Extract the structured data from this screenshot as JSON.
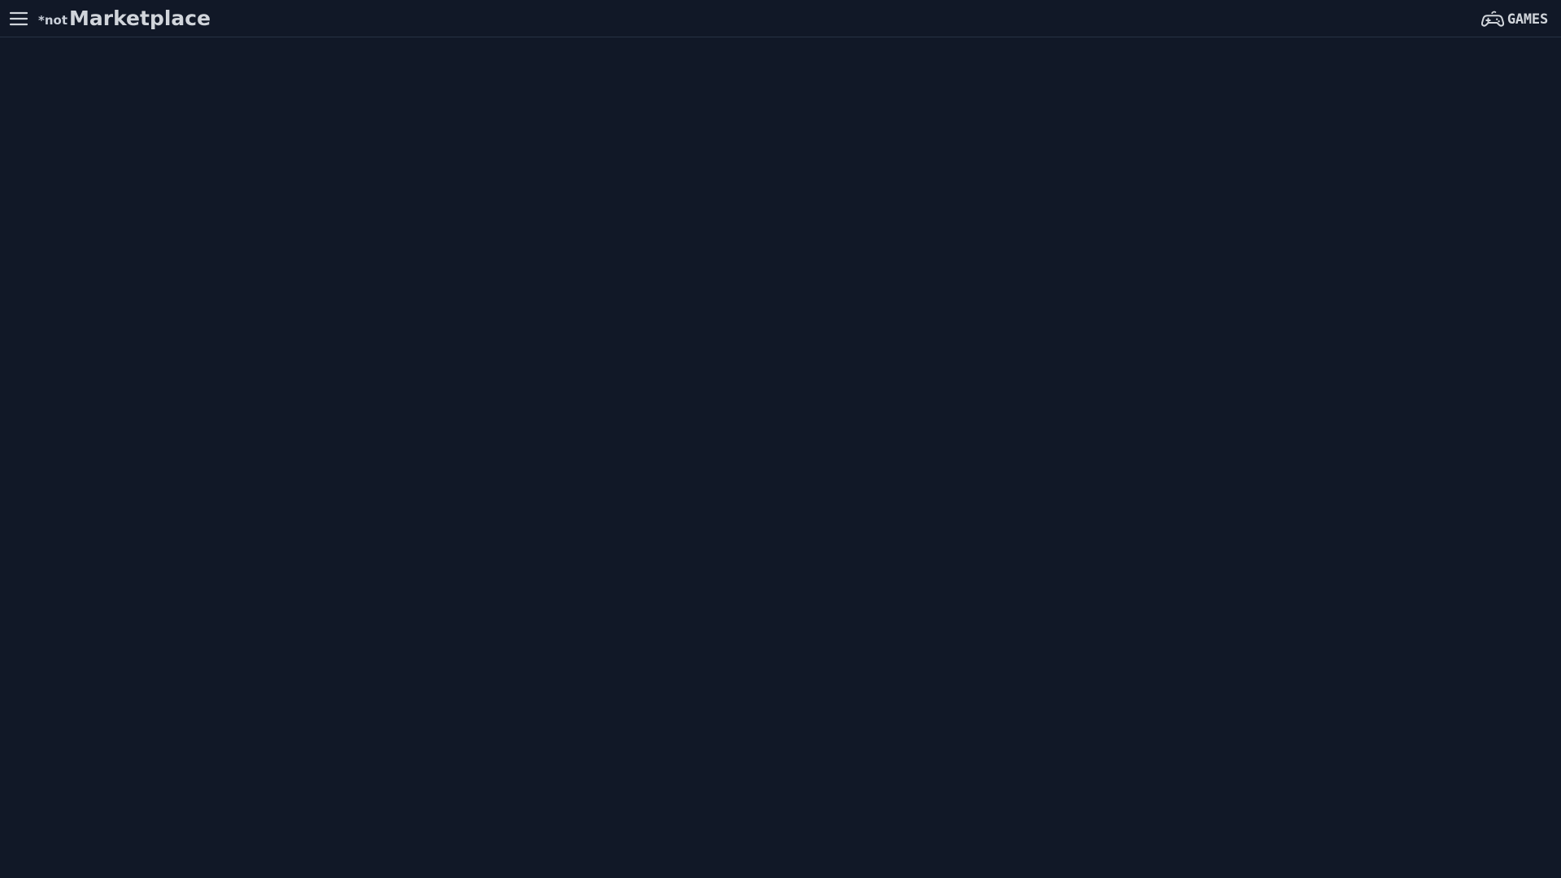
{
  "header": {
    "menu_icon": "hamburger-icon",
    "brand_prefix": "*not",
    "brand_title": "Marketplace",
    "games_icon": "gamepad-icon",
    "games_label": "GAMES"
  },
  "colors": {
    "background": "#111827",
    "text": "#d1d5db",
    "divider": "#273244"
  }
}
